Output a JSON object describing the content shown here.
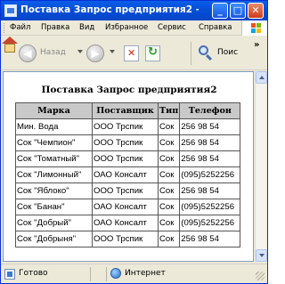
{
  "window": {
    "title": "Поставка Запрос предприятия2 - Mic..."
  },
  "menu": {
    "items": [
      "Файл",
      "Правка",
      "Вид",
      "Избранное",
      "Сервис",
      "Справка"
    ]
  },
  "toolbar": {
    "back_label": "Назад",
    "search_label": "Поис"
  },
  "page": {
    "title": "Поставка Запрос предприятия2",
    "columns": [
      "Марка",
      "Поставщик",
      "Тип",
      "Телефон"
    ],
    "rows": [
      [
        "Мин. Вода",
        "ООО Трспик",
        "Сок",
        "256 98 54"
      ],
      [
        "Сок \"Чемпион\"",
        "ООО Трспик",
        "Сок",
        "256 98 54"
      ],
      [
        "Сок \"Томатный\"",
        "ООО Трспик",
        "Сок",
        "256 98 54"
      ],
      [
        "Сок \"Лимонный\"",
        "ОАО Консалт",
        "Сок",
        "(095)5252256"
      ],
      [
        "Сок \"Яблоко\"",
        "ООО Трспик",
        "Сок",
        "256 98 54"
      ],
      [
        "Сок \"Банан\"",
        "ОАО Консалт",
        "Сок",
        "(095)5252256"
      ],
      [
        "Сок \"Добрый\"",
        "ОАО Консалт",
        "Сок",
        "(095)5252256"
      ],
      [
        "Сок \"Добрыня\"",
        "ООО Трспик",
        "Сок",
        "256 98 54"
      ]
    ]
  },
  "status": {
    "text": "Готово",
    "zone": "Интернет"
  }
}
